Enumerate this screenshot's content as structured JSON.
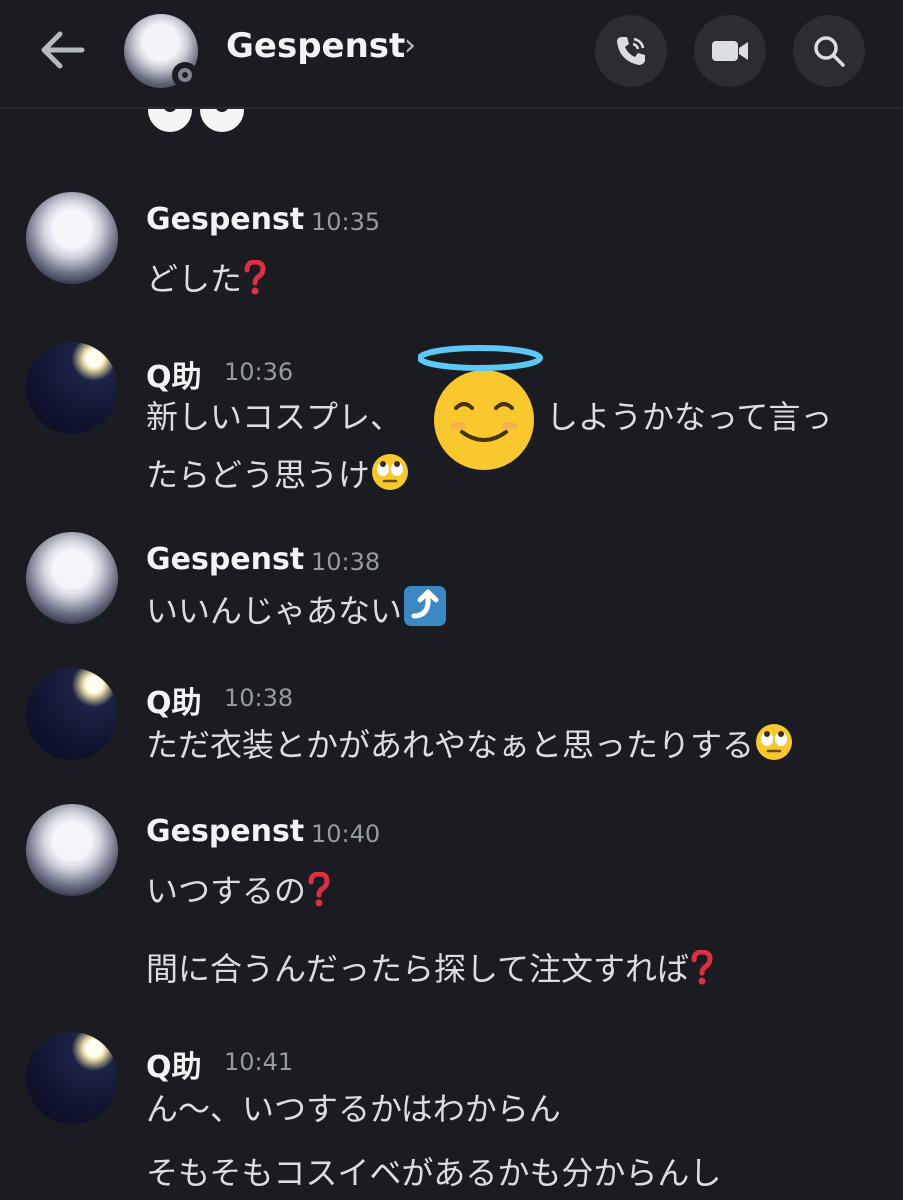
{
  "header": {
    "title": "Gespenst",
    "chevron": "›",
    "back_icon": "arrow-left-icon",
    "call_icon": "phone-icon",
    "video_icon": "video-camera-icon",
    "search_icon": "search-icon",
    "status": "offline"
  },
  "messages": [
    {
      "author": "Gespenst",
      "time": "10:35",
      "lines": [
        "どした"
      ]
    },
    {
      "author": "Q助",
      "time": "10:36",
      "lines": [
        "新しいコスプレ、",
        "しようかなって言っ",
        "たらどう思うけ"
      ]
    },
    {
      "author": "Gespenst",
      "time": "10:38",
      "lines": [
        "いいんじゃあない"
      ]
    },
    {
      "author": "Q助",
      "time": "10:38",
      "lines": [
        "ただ衣装とかがあれやなぁと思ったりする"
      ]
    },
    {
      "author": "Gespenst",
      "time": "10:40",
      "lines": [
        "いつするの",
        "間に合うんだったら探して注文すれば"
      ]
    },
    {
      "author": "Q助",
      "time": "10:41",
      "lines": [
        "ん〜、いつするかはわからん",
        "そもそもコスイベがあるかも分からんし"
      ]
    }
  ],
  "colors": {
    "background": "#1b1c21",
    "text": "#dbdee1",
    "timestamp": "#949ba4",
    "question_mark": "#dd2e44",
    "arrow_emoji_bg": "#3b88c3"
  },
  "emojis": {
    "question": "red-question-mark-emoji",
    "eye_roll": "face-with-rolling-eyes-emoji",
    "halo": "smiling-face-with-halo-emoji",
    "arrow_up": "arrow-curving-up-emoji",
    "eyes": "eyes-emoji"
  }
}
